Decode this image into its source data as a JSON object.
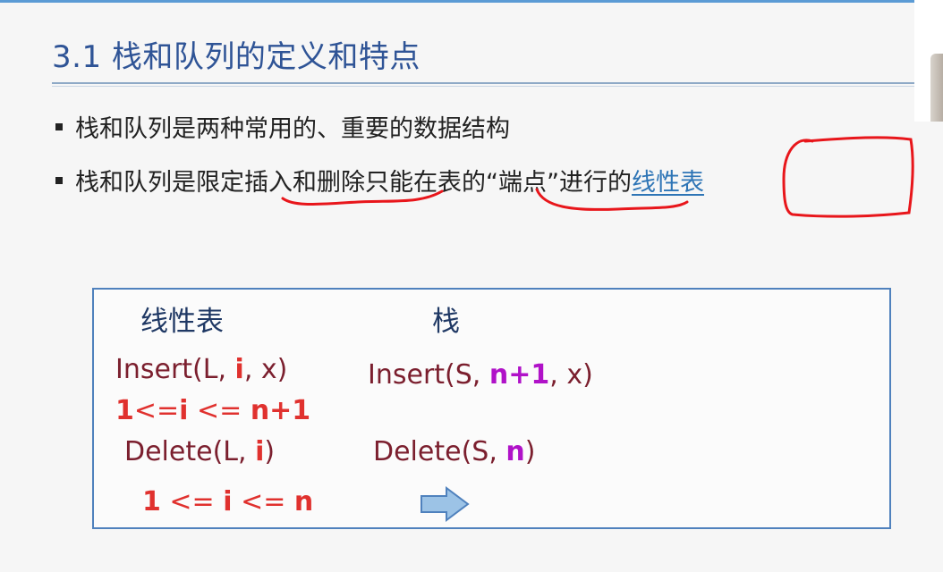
{
  "slide": {
    "title": "3.1 栈和队列的定义和特点",
    "bullets": [
      {
        "text": "栈和队列是两种常用的、重要的数据结构"
      },
      {
        "text_before": "栈和队列是限定插入和删除只能在表的“端点”进行的",
        "link": "线性表"
      }
    ]
  },
  "table": {
    "col1_header": "线性表",
    "col2_header": "栈",
    "insert_linear": {
      "prefix": "Insert(L, ",
      "param": "i",
      "suffix": ", x)"
    },
    "insert_linear_range": {
      "p1": "1",
      "p2": "<=",
      "p3": "i",
      "p4": " <= ",
      "p5": "n+1"
    },
    "delete_linear": {
      "prefix": "Delete(L, ",
      "param": "i",
      "suffix": ")"
    },
    "delete_linear_range": {
      "p1": "1",
      "p2": " <= ",
      "p3": "i",
      "p4": " <= ",
      "p5": "n"
    },
    "insert_stack": {
      "prefix": "Insert(S, ",
      "param": "n+1",
      "suffix": ", x)"
    },
    "delete_stack": {
      "prefix": "Delete(S, ",
      "param": "n",
      "suffix": ")"
    }
  },
  "colors": {
    "title": "#2f5496",
    "accent_rule": "#5b9bd5",
    "link": "#2e75b6",
    "annotation": "#e8161b",
    "function_text": "#7b1f2e",
    "parameter_red": "#e0312e",
    "parameter_purple": "#b012c8",
    "arrow_fill": "#9cc3e6"
  },
  "icons": {
    "arrow": "right-arrow-icon"
  }
}
